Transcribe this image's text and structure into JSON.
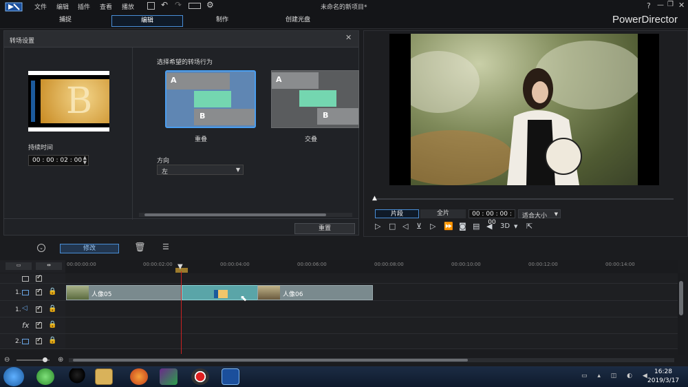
{
  "menu": [
    "文件",
    "编辑",
    "插件",
    "查看",
    "播放"
  ],
  "project_title": "未命名的新项目*",
  "nav_tabs": [
    "捕捉",
    "编辑",
    "制作",
    "创建光盘"
  ],
  "app_name": "PowerDirector",
  "window_controls": {
    "help": "?"
  },
  "transition_panel": {
    "title": "转场设置",
    "thumb_letter": "B",
    "duration_label": "持续时间",
    "duration_value": "00 : 00 : 02 : 00",
    "behavior_label": "选择希望的转场行为",
    "options": [
      {
        "label": "重叠",
        "a": "A",
        "b": "B",
        "selected": true
      },
      {
        "label": "交叠",
        "a": "A",
        "b": "B",
        "selected": false
      }
    ],
    "direction_label": "方向",
    "direction_value": "左",
    "reset_button": "重置"
  },
  "preview": {
    "clip_btn": "片段",
    "movie_btn": "全片",
    "timecode": "00 : 00 : 00 : 00",
    "fit_value": "适合大小",
    "mode_3d": "3D"
  },
  "toolbar": {
    "modify_button": "修改"
  },
  "ruler_ticks": [
    "00:00:00:00",
    "00:00:02:00",
    "00:00:04:00",
    "00:00:06:00",
    "00:00:08:00",
    "00:00:10:00",
    "00:00:12:00",
    "00:00:14:00"
  ],
  "tracks": [
    {
      "num": "",
      "type": "video-master"
    },
    {
      "num": "1.",
      "type": "video"
    },
    {
      "num": "1.",
      "type": "audio"
    },
    {
      "num": "",
      "type": "fx",
      "label": "fx"
    },
    {
      "num": "2.",
      "type": "video"
    }
  ],
  "clips": [
    {
      "name": "人像05"
    },
    {
      "name": "人像06"
    }
  ],
  "clock": {
    "time": "16:28",
    "date": "2019/3/17"
  },
  "colors": {
    "accent": "#4a8fd8",
    "clip": "#7a8a8e",
    "transition": "#5aa5a8",
    "selected_option": "#5f86b3"
  }
}
